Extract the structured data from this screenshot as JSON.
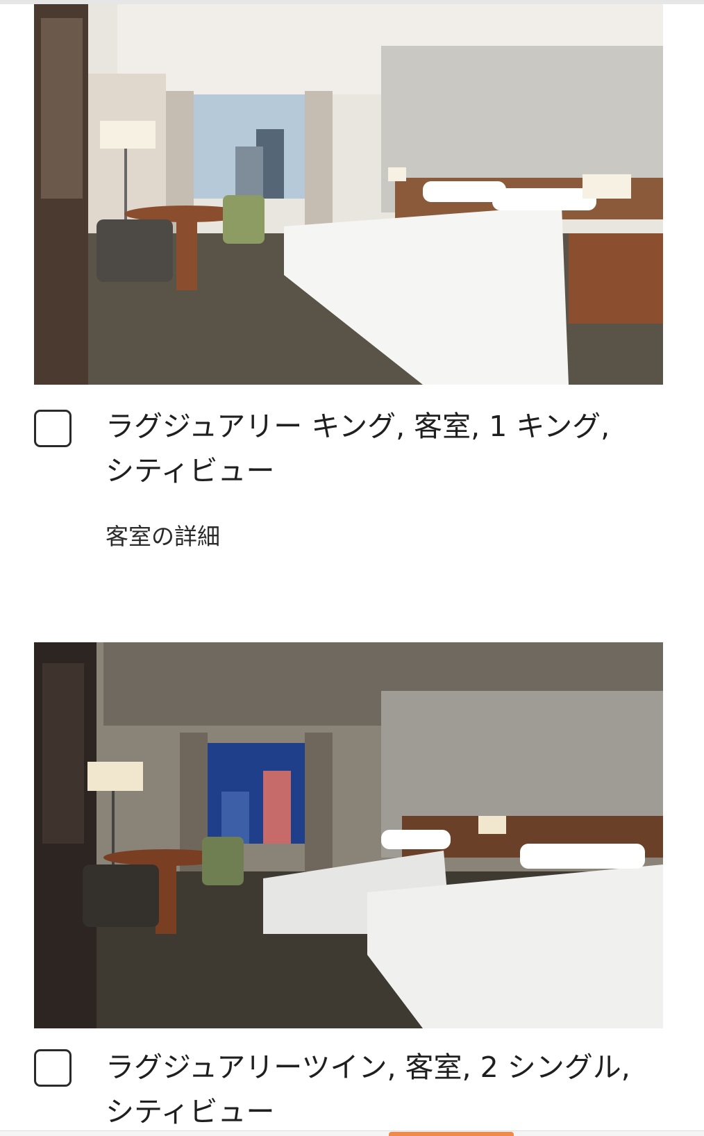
{
  "rooms": [
    {
      "title": "ラグジュアリー キング, 客室, 1 キング, シティビュー",
      "details_link": "客室の詳細",
      "checked": false
    },
    {
      "title": "ラグジュアリーツイン, 客室, 2 シングル, シティビュー",
      "checked": false
    }
  ],
  "colors": {
    "accent": "#f08a4b",
    "text": "#1f1f1f"
  }
}
